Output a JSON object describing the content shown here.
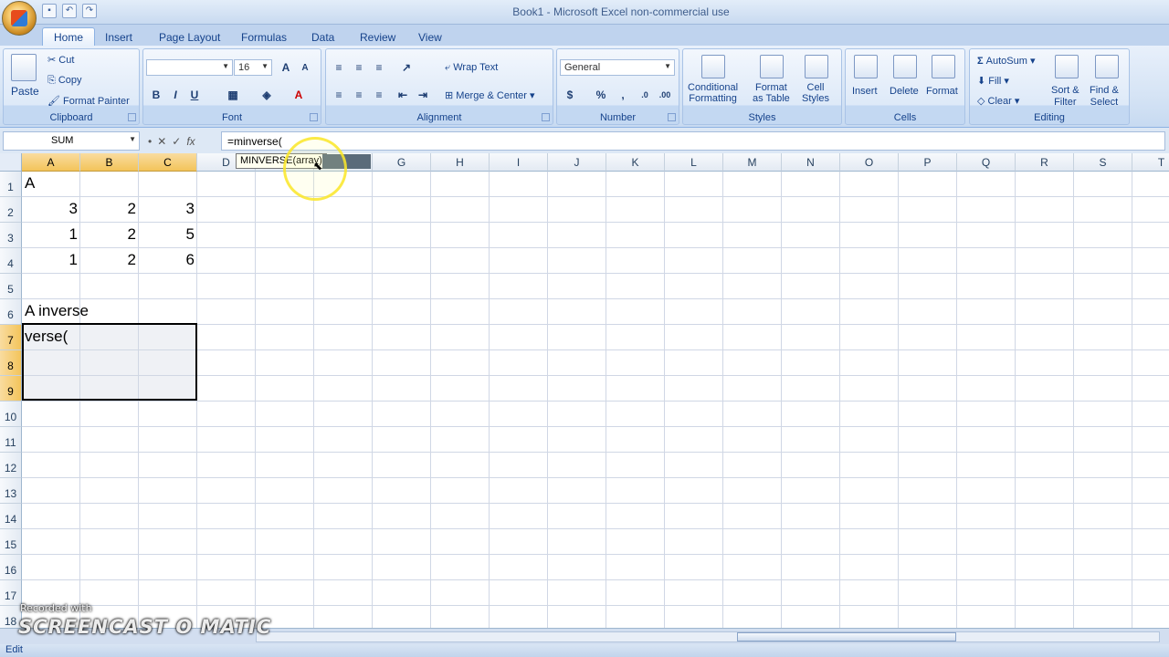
{
  "window": {
    "title": "Book1 - Microsoft Excel non-commercial use"
  },
  "tabs": [
    "Home",
    "Insert",
    "Page Layout",
    "Formulas",
    "Data",
    "Review",
    "View"
  ],
  "ribbon": {
    "clipboard": {
      "label": "Clipboard",
      "paste": "Paste",
      "cut": "Cut",
      "copy": "Copy",
      "format_painter": "Format Painter"
    },
    "font": {
      "label": "Font",
      "font_name": "",
      "font_size": "16",
      "bold": "B",
      "italic": "I",
      "underline": "U"
    },
    "alignment": {
      "label": "Alignment",
      "wrap_text": "Wrap Text",
      "merge_center": "Merge & Center"
    },
    "number": {
      "label": "Number",
      "format": "General"
    },
    "styles": {
      "label": "Styles",
      "conditional": "Conditional\nFormatting",
      "format_table": "Format\nas Table",
      "cell_styles": "Cell\nStyles"
    },
    "cells": {
      "label": "Cells",
      "insert": "Insert",
      "delete": "Delete",
      "format": "Format"
    },
    "editing": {
      "label": "Editing",
      "autosum": "AutoSum",
      "fill": "Fill",
      "clear": "Clear",
      "sort_filter": "Sort &\nFilter",
      "find_select": "Find &\nSelect"
    }
  },
  "formula_bar": {
    "name_box": "SUM",
    "formula": "=minverse(",
    "tooltip": "MINVERSE(array)"
  },
  "columns": [
    "A",
    "B",
    "C",
    "D",
    "E",
    "F",
    "G",
    "H",
    "I",
    "J",
    "K",
    "L",
    "M",
    "N",
    "O",
    "P",
    "Q",
    "R",
    "S",
    "T"
  ],
  "rows": [
    "1",
    "2",
    "3",
    "4",
    "5",
    "6",
    "7",
    "8",
    "9",
    "10",
    "11",
    "12",
    "13",
    "14",
    "15",
    "16",
    "17",
    "18"
  ],
  "cells": {
    "A1": "A",
    "A2": "3",
    "B2": "2",
    "C2": "3",
    "A3": "1",
    "B3": "2",
    "C3": "5",
    "A4": "1",
    "B4": "2",
    "C4": "6",
    "A6": "A inverse",
    "A7": "verse("
  },
  "status": {
    "mode": "Edit"
  },
  "watermark": {
    "recorded": "Recorded with",
    "brand": "SCREENCAST O MATIC"
  },
  "colors": {
    "selected_header": "#f3c45a",
    "ribbon_bg": "#dde8f5",
    "text_blue": "#15428b"
  }
}
